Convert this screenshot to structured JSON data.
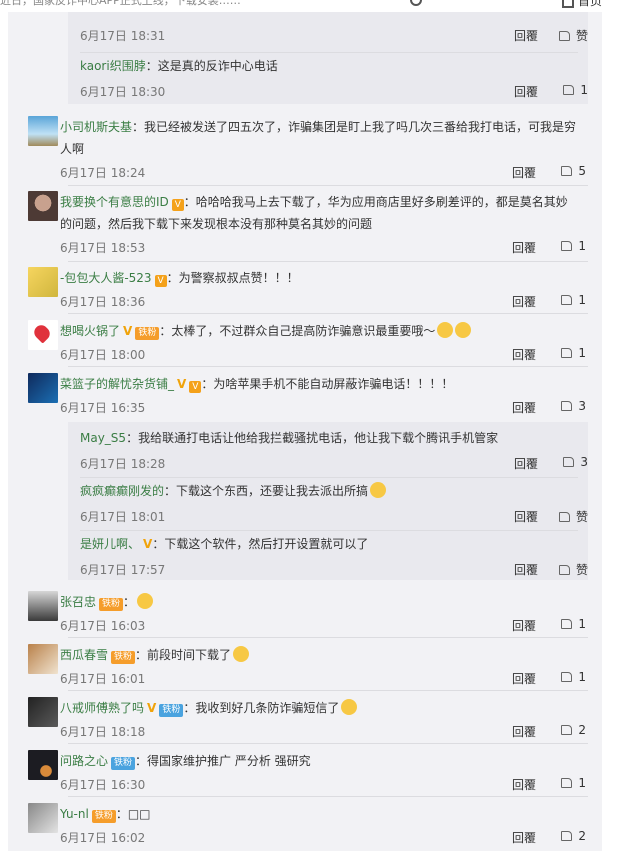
{
  "topbar": {
    "search_text": "近日，国家反诈中心APP正式上线，下载安装……",
    "home_label": "首页"
  },
  "thread_top": [
    {
      "user": "",
      "text": "",
      "time": "6月17日 18:31",
      "likes": "赞"
    },
    {
      "user": "kaori织围脖",
      "text": "：这是真的反诈中心电话",
      "time": "6月17日 18:30",
      "likes": "1"
    }
  ],
  "comments": [
    {
      "user": "小司机斯夫基",
      "text": "：我已经被发送了四五次了，诈骗集团是盯上我了吗几次三番给我打电话，可我是穷",
      "text2": "人啊",
      "time": "6月17日 18:24",
      "likes": "5"
    },
    {
      "user": "我要换个有意思的ID",
      "text": "：哈哈哈我马上去下载了，华为应用商店里好多刷差评的，都是莫名其妙",
      "text2": "的问题，然后我下载下来发现根本没有那种莫名其妙的问题",
      "time": "6月17日 18:53",
      "likes": "1"
    },
    {
      "user": "-包包大人酱-523",
      "text": "：为警察叔叔点赞！！！",
      "time": "6月17日 18:36",
      "likes": "1"
    },
    {
      "user": "想喝火锅了",
      "badge": "铁粉",
      "text": "：太棒了，不过群众自己提高防诈骗意识最重要哦～",
      "time": "6月17日 18:00",
      "likes": "1"
    },
    {
      "user": "菜篮子的解忧杂货铺_",
      "text": "：为啥苹果手机不能自动屏蔽诈骗电话！！！！",
      "time": "6月17日 16:35",
      "likes": "3"
    }
  ],
  "replies": [
    {
      "user": "May_S5",
      "text": "：我给联通打电话让他给我拦截骚扰电话，他让我下载个腾讯手机管家",
      "time": "6月17日 18:28",
      "likes": "3"
    },
    {
      "user": "疯疯癫癫刚发的",
      "text": "：下载这个东西，还要让我去派出所搞",
      "time": "6月17日 18:01",
      "likes": "赞"
    },
    {
      "user": "是妍儿啊、",
      "text": "：下载这个软件，然后打开设置就可以了",
      "time": "6月17日 17:57",
      "likes": "赞"
    }
  ],
  "comments2": [
    {
      "user": "张召忠",
      "badge": "铁粉",
      "text": "：",
      "time": "6月17日 16:03",
      "likes": "1"
    },
    {
      "user": "西瓜春雪",
      "badge": "铁粉",
      "text": "：前段时间下载了",
      "time": "6月17日 16:01",
      "likes": "1"
    },
    {
      "user": "八戒师傅熟了吗",
      "badge": "铁粉",
      "text": "：我收到好几条防诈骗短信了",
      "time": "6月17日 18:18",
      "likes": "2"
    },
    {
      "user": "问路之心",
      "badge": "铁粉",
      "text": "：得国家维护推广 严分析 强研究",
      "time": "6月17日 16:30",
      "likes": "1"
    },
    {
      "user": "Yu-nl",
      "badge": "铁粉",
      "text": "：□□",
      "time": "6月17日 16:02",
      "likes": "2"
    }
  ],
  "labels": {
    "reply": "回覆"
  }
}
